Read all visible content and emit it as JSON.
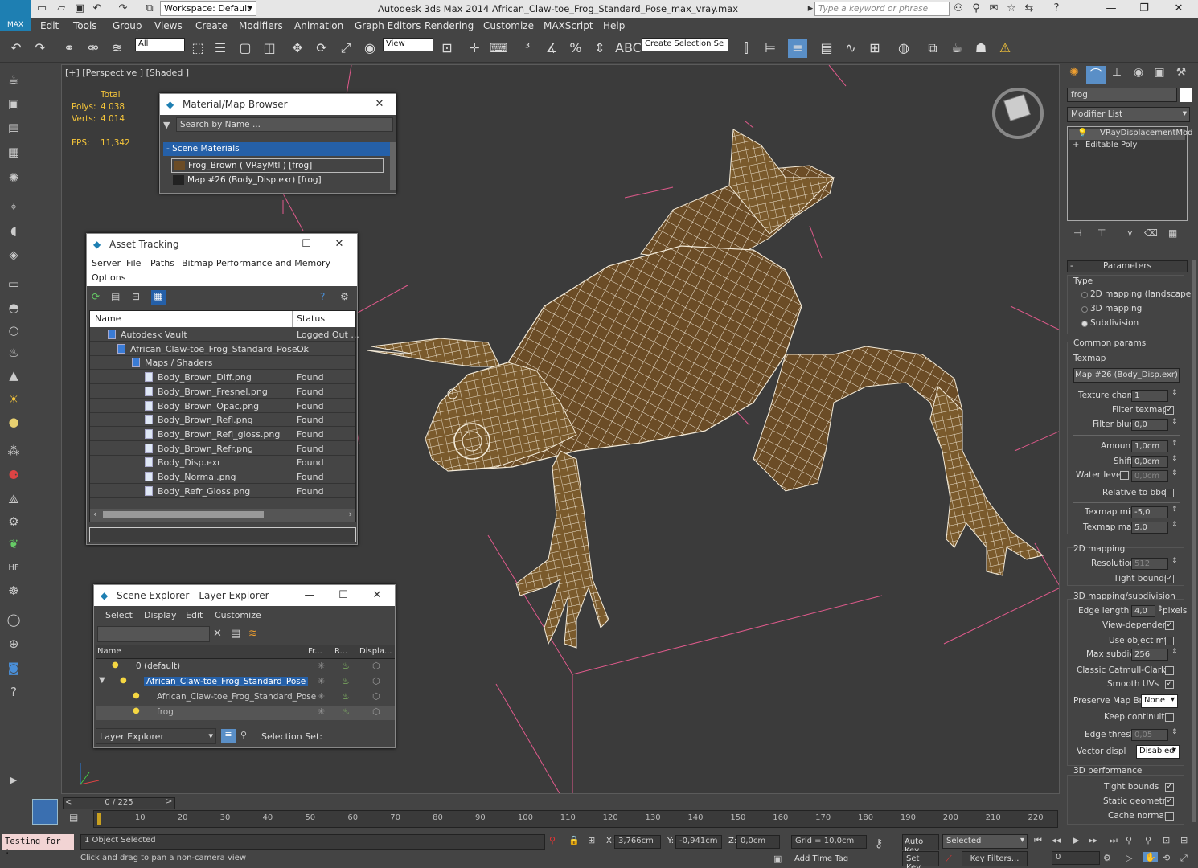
{
  "titlebar": {
    "workspace": "Workspace: Default",
    "app_title": "Autodesk 3ds Max  2014     African_Claw-toe_Frog_Standard_Pose_max_vray.max",
    "search_placeholder": "Type a keyword or phrase",
    "logo_text": "MAX"
  },
  "menu": [
    "Edit",
    "Tools",
    "Group",
    "Views",
    "Create",
    "Modifiers",
    "Animation",
    "Graph Editors",
    "Rendering",
    "Customize",
    "MAXScript",
    "Help"
  ],
  "toolbar": {
    "selection_filter": "All",
    "ref_coord": "View",
    "named_selection": "Create Selection Se"
  },
  "viewport": {
    "label": "[+] [Perspective ] [Shaded ]",
    "stats_total_label": "Total",
    "polys_label": "Polys:",
    "polys_value": "4 038",
    "verts_label": "Verts:",
    "verts_value": "4 014",
    "fps_label": "FPS:",
    "fps_value": "11,342"
  },
  "material_browser": {
    "title": "Material/Map Browser",
    "search_placeholder": "Search by Name ...",
    "group": "- Scene Materials",
    "items": [
      "Frog_Brown  ( VRayMtl )  [frog]",
      "Map #26 (Body_Disp.exr)  [frog]"
    ]
  },
  "asset_tracking": {
    "title": "Asset Tracking",
    "menu": [
      "Server",
      "File",
      "Paths",
      "Bitmap Performance and Memory",
      "Options"
    ],
    "col_name": "Name",
    "col_status": "Status",
    "rows": [
      {
        "name": "Autodesk Vault",
        "status": "Logged Out ..."
      },
      {
        "name": "African_Claw-toe_Frog_Standard_Pose...",
        "status": "Ok"
      },
      {
        "name": "Maps / Shaders",
        "status": ""
      },
      {
        "name": "Body_Brown_Diff.png",
        "status": "Found"
      },
      {
        "name": "Body_Brown_Fresnel.png",
        "status": "Found"
      },
      {
        "name": "Body_Brown_Opac.png",
        "status": "Found"
      },
      {
        "name": "Body_Brown_Refl.png",
        "status": "Found"
      },
      {
        "name": "Body_Brown_Refl_gloss.png",
        "status": "Found"
      },
      {
        "name": "Body_Brown_Refr.png",
        "status": "Found"
      },
      {
        "name": "Body_Disp.exr",
        "status": "Found"
      },
      {
        "name": "Body_Normal.png",
        "status": "Found"
      },
      {
        "name": "Body_Refr_Gloss.png",
        "status": "Found"
      }
    ]
  },
  "scene_explorer": {
    "title": "Scene Explorer - Layer Explorer",
    "menu": [
      "Select",
      "Display",
      "Edit",
      "Customize"
    ],
    "col_name": "Name",
    "col_fr": "Fr...",
    "col_r": "R...",
    "col_disp": "Displa...",
    "rows": [
      "0 (default)",
      "African_Claw-toe_Frog_Standard_Pose",
      "African_Claw-toe_Frog_Standard_Pose",
      "frog"
    ],
    "footer_dropdown": "Layer Explorer",
    "footer_selset": "Selection Set:"
  },
  "command_panel": {
    "object_name": "frog",
    "modifier_list": "Modifier List",
    "stack": [
      "VRayDisplacementMod",
      "Editable Poly"
    ],
    "rollout_title": "Parameters",
    "type_label": "Type",
    "type_options": [
      "2D mapping (landscape)",
      "3D mapping",
      "Subdivision"
    ],
    "common_params": "Common params",
    "texmap_label": "Texmap",
    "texmap_button": "Map #26 (Body_Disp.exr)",
    "texture_chan_label": "Texture chan",
    "texture_chan": "1",
    "filter_texmap_label": "Filter texmap",
    "filter_blur_label": "Filter blur",
    "filter_blur": "0,0",
    "amount_label": "Amount",
    "amount": "1,0cm",
    "shift_label": "Shift",
    "shift": "0,0cm",
    "water_level_label": "Water level",
    "water_level": "0,0cm",
    "relative_bbox_label": "Relative to bbox",
    "texmap_min_label": "Texmap min",
    "texmap_min": "-5,0",
    "texmap_max_label": "Texmap max",
    "texmap_max": "5,0",
    "mapping2d_label": "2D mapping",
    "resolution_label": "Resolution",
    "resolution": "512",
    "tight_bounds_label": "Tight bounds",
    "mapping3d_label": "3D mapping/subdivision",
    "edge_length_label": "Edge length",
    "edge_length": "4,0",
    "pixels_label": "pixels",
    "view_dependent_label": "View-dependent",
    "use_object_mtl_label": "Use object mtl",
    "max_subdivs_label": "Max subdivs",
    "max_subdivs": "256",
    "classic_cc_label": "Classic Catmull-Clark",
    "smooth_uvs_label": "Smooth UVs",
    "preserve_map_bnd_label": "Preserve Map Bnd",
    "preserve_map_bnd": "None",
    "keep_continuity_label": "Keep continuity",
    "edge_thresh_label": "Edge thresh",
    "edge_thresh": "0,05",
    "vector_displ_label": "Vector displ",
    "vector_displ": "Disabled",
    "perf_label": "3D performance",
    "perf_tight_bounds_label": "Tight bounds",
    "static_geometry_label": "Static geometry",
    "cache_normals_label": "Cache normals"
  },
  "timeline": {
    "frame_counter": "0 / 225",
    "ticks": [
      "10",
      "20",
      "30",
      "40",
      "50",
      "60",
      "70",
      "80",
      "90",
      "100",
      "110",
      "120",
      "130",
      "140",
      "150",
      "160",
      "170",
      "180",
      "190",
      "200",
      "210",
      "220"
    ]
  },
  "statusbar": {
    "maxscript": "Testing for :",
    "selected": "1 Object Selected",
    "prompt": "Click and drag to pan a non-camera view",
    "x_label": "X:",
    "x": "3,766cm",
    "y_label": "Y:",
    "y": "-0,941cm",
    "z_label": "Z:",
    "z": "0,0cm",
    "grid": "Grid = 10,0cm",
    "add_time_tag": "Add Time Tag",
    "auto_key": "Auto Key",
    "set_key": "Set Key",
    "key_mode": "Selected",
    "key_filters": "Key Filters...",
    "frame": "0"
  }
}
